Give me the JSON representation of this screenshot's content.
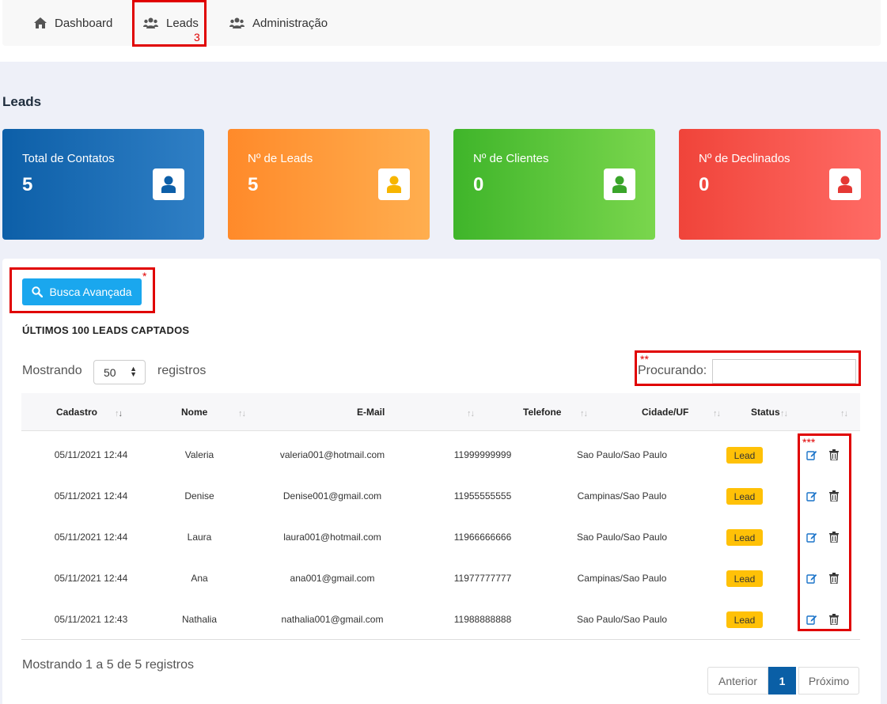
{
  "nav": {
    "items": [
      {
        "label": "Dashboard",
        "icon": "home-icon"
      },
      {
        "label": "Leads",
        "icon": "users-icon"
      },
      {
        "label": "Administração",
        "icon": "users-icon"
      }
    ]
  },
  "annotations": {
    "leads_number": "3",
    "search_mark": "*",
    "filter_mark": "**",
    "actions_mark": "***"
  },
  "page": {
    "title": "Leads"
  },
  "cards": [
    {
      "label": "Total de Contatos",
      "value": "5",
      "color": "#1565ae",
      "icon_color": "#0d5fa8"
    },
    {
      "label": "Nº de Leads",
      "value": "5",
      "color": "#ff9a3c",
      "icon_color": "#f7b500"
    },
    {
      "label": "Nº de Clientes",
      "value": "0",
      "color": "#56c43a",
      "icon_color": "#3aa52a"
    },
    {
      "label": "Nº de Declinados",
      "value": "0",
      "color": "#f5504a",
      "icon_color": "#e53935"
    }
  ],
  "search_button": {
    "label": "Busca Avançada",
    "icon": "search-icon"
  },
  "section_title": "ÚLTIMOS 100 LEADS CAPTADOS",
  "length_control": {
    "prefix": "Mostrando",
    "value": "50",
    "suffix": "registros"
  },
  "filter": {
    "label": "Procurando:",
    "value": ""
  },
  "table": {
    "headers": [
      "Cadastro",
      "Nome",
      "E-Mail",
      "Telefone",
      "Cidade/UF",
      "Status"
    ],
    "rows": [
      {
        "cadastro": "05/11/2021 12:44",
        "nome": "Valeria",
        "email": "valeria001@hotmail.com",
        "telefone": "11999999999",
        "cidade": "Sao Paulo/Sao Paulo",
        "status": "Lead"
      },
      {
        "cadastro": "05/11/2021 12:44",
        "nome": "Denise",
        "email": "Denise001@gmail.com",
        "telefone": "11955555555",
        "cidade": "Campinas/Sao Paulo",
        "status": "Lead"
      },
      {
        "cadastro": "05/11/2021 12:44",
        "nome": "Laura",
        "email": "laura001@hotmail.com",
        "telefone": "11966666666",
        "cidade": "Sao Paulo/Sao Paulo",
        "status": "Lead"
      },
      {
        "cadastro": "05/11/2021 12:44",
        "nome": "Ana",
        "email": "ana001@gmail.com",
        "telefone": "11977777777",
        "cidade": "Campinas/Sao Paulo",
        "status": "Lead"
      },
      {
        "cadastro": "05/11/2021 12:43",
        "nome": "Nathalia",
        "email": "nathalia001@gmail.com",
        "telefone": "11988888888",
        "cidade": "Sao Paulo/Sao Paulo",
        "status": "Lead"
      }
    ],
    "row_actions": [
      "edit-icon",
      "trash-icon"
    ]
  },
  "footer": {
    "info": "Mostrando 1 a 5 de 5 registros"
  },
  "pagination": {
    "prev": "Anterior",
    "current": "1",
    "next": "Próximo"
  },
  "colors": {
    "accent_blue": "#1aa7ee",
    "status_lead": "#ffc107",
    "annotation_red": "#e00000",
    "page_active": "#0a5fa6"
  }
}
